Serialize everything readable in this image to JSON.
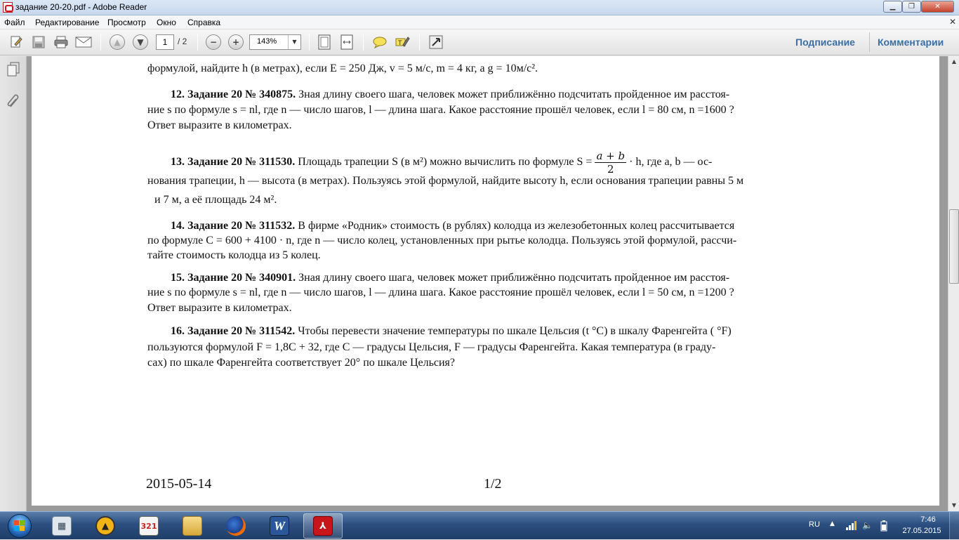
{
  "window": {
    "title": "задание 20-20.pdf - Adobe Reader"
  },
  "menubar": {
    "items": [
      "Файл",
      "Редактирование",
      "Просмотр",
      "Окно",
      "Справка"
    ]
  },
  "toolbar": {
    "page_current": "1",
    "page_total": "/ 2",
    "zoom": "143%",
    "sign_label": "Подписание",
    "comments_label": "Комментарии"
  },
  "document": {
    "line_top": "формулой, найдите h (в метрах), если E = 250 Дж, v = 5 м/с, m = 4 кг, а g = 10м/с².",
    "p12_head": "12. Задание 20 № 340875.",
    "p12_l1": "Зная длину своего шага, человек может приближённо подсчитать пройденное им расстоя-",
    "p12_l2": "ние s по формуле s = nl, где n — число шагов, l — длина шага. Какое расстояние прошёл человек, если l = 80 см, n =1600 ?",
    "p12_l3": "Ответ выразите в километрах.",
    "p13_head": "13. Задание 20 № 311530.",
    "p13_l1a": "Площадь трапеции S (в м²)  можно вычислить по формуле S =",
    "p13_frac_num": "a + b",
    "p13_frac_den": "2",
    "p13_l1b": "· h, где  a,  b — ос-",
    "p13_l2": "нования трапеции,  h — высота (в метрах). Пользуясь этой формулой, найдите высоту  h, если основания трапеции равны  5  м",
    "p13_l3": "и  7  м, а её площадь  24  м².",
    "p14_head": "14. Задание 20 № 311532.",
    "p14_l1": "В фирме «Родник» стоимость (в рублях) колодца из железобетонных колец рассчитывается",
    "p14_l2": "по формуле  C = 600 + 4100 · n, где  n — число колец, установленных при рытье колодца. Пользуясь этой формулой, рассчи-",
    "p14_l3": "тайте стоимость колодца из 5 колец.",
    "p15_head": "15. Задание 20 № 340901.",
    "p15_l1": "Зная длину своего шага, человек может приближённо подсчитать пройденное им расстоя-",
    "p15_l2": "ние s по формуле s = nl, где n — число шагов, l — длина шага. Какое расстояние прошёл человек, если l = 50 см, n =1200 ?",
    "p15_l3": "Ответ выразите в километрах.",
    "p16_head": "16. Задание 20 № 311542.",
    "p16_l1": "Чтобы перевести значение температуры по шкале Цельсия (t °C) в шкалу Фаренгейта ( °F)",
    "p16_l2": "пользуются  формулой  F = 1,8C + 32, где C — градусы Цельсия, F — градусы Фаренгейта. Какая температура (в граду-",
    "p16_l3": "сах) по шкале Фаренгейта соответствует 20° по шкале Цельсия?",
    "footer_date": "2015-05-14",
    "footer_page": "1/2"
  },
  "taskbar": {
    "lang": "RU",
    "time": "7:46",
    "date": "27.05.2015"
  }
}
